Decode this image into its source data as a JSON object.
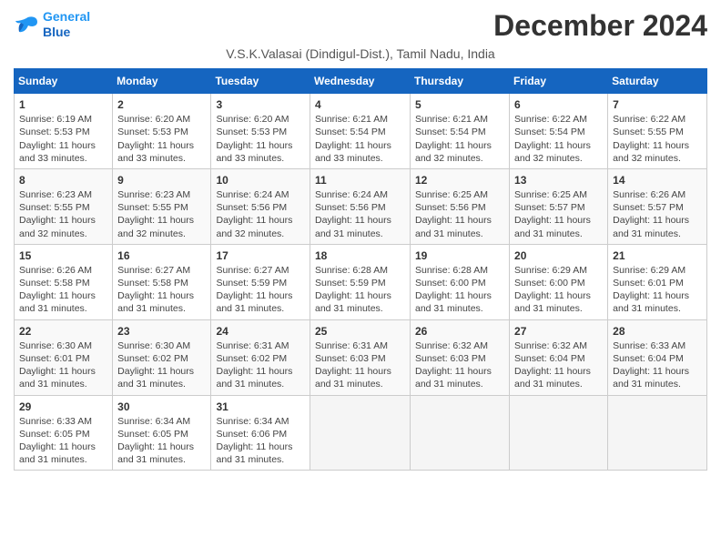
{
  "logo": {
    "line1": "General",
    "line2": "Blue",
    "bird_color": "#2196f3"
  },
  "title": "December 2024",
  "subtitle": "V.S.K.Valasai (Dindigul-Dist.), Tamil Nadu, India",
  "days_of_week": [
    "Sunday",
    "Monday",
    "Tuesday",
    "Wednesday",
    "Thursday",
    "Friday",
    "Saturday"
  ],
  "weeks": [
    [
      {
        "day": "1",
        "info": "Sunrise: 6:19 AM\nSunset: 5:53 PM\nDaylight: 11 hours\nand 33 minutes."
      },
      {
        "day": "2",
        "info": "Sunrise: 6:20 AM\nSunset: 5:53 PM\nDaylight: 11 hours\nand 33 minutes."
      },
      {
        "day": "3",
        "info": "Sunrise: 6:20 AM\nSunset: 5:53 PM\nDaylight: 11 hours\nand 33 minutes."
      },
      {
        "day": "4",
        "info": "Sunrise: 6:21 AM\nSunset: 5:54 PM\nDaylight: 11 hours\nand 33 minutes."
      },
      {
        "day": "5",
        "info": "Sunrise: 6:21 AM\nSunset: 5:54 PM\nDaylight: 11 hours\nand 32 minutes."
      },
      {
        "day": "6",
        "info": "Sunrise: 6:22 AM\nSunset: 5:54 PM\nDaylight: 11 hours\nand 32 minutes."
      },
      {
        "day": "7",
        "info": "Sunrise: 6:22 AM\nSunset: 5:55 PM\nDaylight: 11 hours\nand 32 minutes."
      }
    ],
    [
      {
        "day": "8",
        "info": "Sunrise: 6:23 AM\nSunset: 5:55 PM\nDaylight: 11 hours\nand 32 minutes."
      },
      {
        "day": "9",
        "info": "Sunrise: 6:23 AM\nSunset: 5:55 PM\nDaylight: 11 hours\nand 32 minutes."
      },
      {
        "day": "10",
        "info": "Sunrise: 6:24 AM\nSunset: 5:56 PM\nDaylight: 11 hours\nand 32 minutes."
      },
      {
        "day": "11",
        "info": "Sunrise: 6:24 AM\nSunset: 5:56 PM\nDaylight: 11 hours\nand 31 minutes."
      },
      {
        "day": "12",
        "info": "Sunrise: 6:25 AM\nSunset: 5:56 PM\nDaylight: 11 hours\nand 31 minutes."
      },
      {
        "day": "13",
        "info": "Sunrise: 6:25 AM\nSunset: 5:57 PM\nDaylight: 11 hours\nand 31 minutes."
      },
      {
        "day": "14",
        "info": "Sunrise: 6:26 AM\nSunset: 5:57 PM\nDaylight: 11 hours\nand 31 minutes."
      }
    ],
    [
      {
        "day": "15",
        "info": "Sunrise: 6:26 AM\nSunset: 5:58 PM\nDaylight: 11 hours\nand 31 minutes."
      },
      {
        "day": "16",
        "info": "Sunrise: 6:27 AM\nSunset: 5:58 PM\nDaylight: 11 hours\nand 31 minutes."
      },
      {
        "day": "17",
        "info": "Sunrise: 6:27 AM\nSunset: 5:59 PM\nDaylight: 11 hours\nand 31 minutes."
      },
      {
        "day": "18",
        "info": "Sunrise: 6:28 AM\nSunset: 5:59 PM\nDaylight: 11 hours\nand 31 minutes."
      },
      {
        "day": "19",
        "info": "Sunrise: 6:28 AM\nSunset: 6:00 PM\nDaylight: 11 hours\nand 31 minutes."
      },
      {
        "day": "20",
        "info": "Sunrise: 6:29 AM\nSunset: 6:00 PM\nDaylight: 11 hours\nand 31 minutes."
      },
      {
        "day": "21",
        "info": "Sunrise: 6:29 AM\nSunset: 6:01 PM\nDaylight: 11 hours\nand 31 minutes."
      }
    ],
    [
      {
        "day": "22",
        "info": "Sunrise: 6:30 AM\nSunset: 6:01 PM\nDaylight: 11 hours\nand 31 minutes."
      },
      {
        "day": "23",
        "info": "Sunrise: 6:30 AM\nSunset: 6:02 PM\nDaylight: 11 hours\nand 31 minutes."
      },
      {
        "day": "24",
        "info": "Sunrise: 6:31 AM\nSunset: 6:02 PM\nDaylight: 11 hours\nand 31 minutes."
      },
      {
        "day": "25",
        "info": "Sunrise: 6:31 AM\nSunset: 6:03 PM\nDaylight: 11 hours\nand 31 minutes."
      },
      {
        "day": "26",
        "info": "Sunrise: 6:32 AM\nSunset: 6:03 PM\nDaylight: 11 hours\nand 31 minutes."
      },
      {
        "day": "27",
        "info": "Sunrise: 6:32 AM\nSunset: 6:04 PM\nDaylight: 11 hours\nand 31 minutes."
      },
      {
        "day": "28",
        "info": "Sunrise: 6:33 AM\nSunset: 6:04 PM\nDaylight: 11 hours\nand 31 minutes."
      }
    ],
    [
      {
        "day": "29",
        "info": "Sunrise: 6:33 AM\nSunset: 6:05 PM\nDaylight: 11 hours\nand 31 minutes."
      },
      {
        "day": "30",
        "info": "Sunrise: 6:34 AM\nSunset: 6:05 PM\nDaylight: 11 hours\nand 31 minutes."
      },
      {
        "day": "31",
        "info": "Sunrise: 6:34 AM\nSunset: 6:06 PM\nDaylight: 11 hours\nand 31 minutes."
      },
      {
        "day": "",
        "info": ""
      },
      {
        "day": "",
        "info": ""
      },
      {
        "day": "",
        "info": ""
      },
      {
        "day": "",
        "info": ""
      }
    ]
  ]
}
